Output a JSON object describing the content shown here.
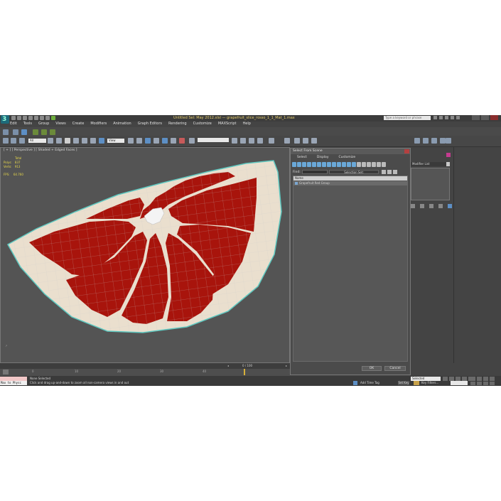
{
  "window": {
    "title": "Untitled Sel: May 2012.xlsl — grapefruit_slice_rosso_1_1_Mat_1.max",
    "search_placeholder": "Type a keyword or phrase"
  },
  "menu": [
    "Edit",
    "Tools",
    "Group",
    "Views",
    "Create",
    "Modifiers",
    "Animation",
    "Graph Editors",
    "Rendering",
    "Customize",
    "MAXScript",
    "Help"
  ],
  "toolbar": {
    "selection_filter": "All",
    "reference_coord": "View",
    "named_selection": ""
  },
  "viewport": {
    "label": "[ + ] [ Perspective ] [ Shaded + Edged Faces ]",
    "stats": {
      "header": "Total",
      "polys_label": "Polys:",
      "polys_value": "837",
      "verts_label": "Verts:",
      "verts_value": "913",
      "fps_label": "FPS:",
      "fps_value": "64.760"
    },
    "slice_colors": {
      "flesh": "#a8140c",
      "rind": "#eadfce",
      "edge": "#5ec8c0",
      "grid": "#c9c9c9"
    }
  },
  "dialog": {
    "title": "Select From Scene",
    "menu": [
      "Select",
      "Display",
      "Customize"
    ],
    "find_label": "Find:",
    "find_value": "",
    "selection_set": "Selection Set:",
    "column_header": "Name",
    "items": [
      "Grapefruit Red Group"
    ],
    "ok_label": "OK",
    "cancel_label": "Cancel"
  },
  "command_panel": {
    "modifier_list": "Modifier List"
  },
  "timeline": {
    "frame_counter": "0 / 100",
    "ticks": [
      "0",
      "10",
      "20",
      "30",
      "40",
      "50",
      "60",
      "70",
      "80",
      "90",
      "100"
    ]
  },
  "statusbar": {
    "maxscript_line1": "",
    "maxscript_line2": "Max to Physc",
    "selection_status": "None Selected",
    "prompt": "Click and drag up-and-down to zoom all non-camera views in and out",
    "add_time_tag": "Add Time Tag",
    "selection_dropdown": "Selected",
    "set_key": "Set Key",
    "key_filters": "Key Filters..."
  }
}
